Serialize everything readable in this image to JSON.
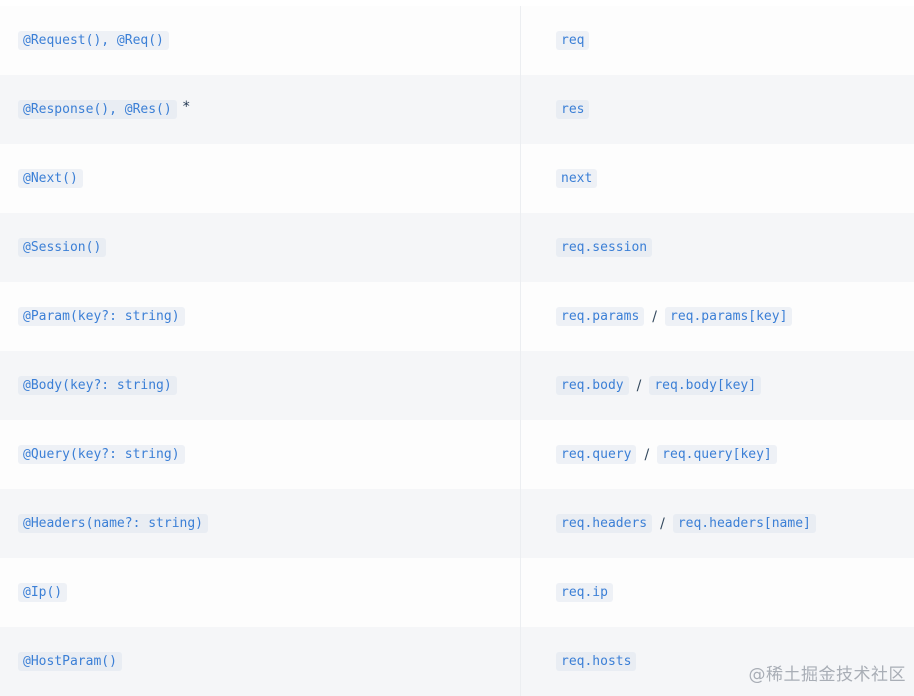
{
  "rows": [
    {
      "decorator": "@Request(), @Req()",
      "note": "",
      "express": [
        "req"
      ]
    },
    {
      "decorator": "@Response(), @Res()",
      "note": "*",
      "express": [
        "res"
      ]
    },
    {
      "decorator": "@Next()",
      "note": "",
      "express": [
        "next"
      ]
    },
    {
      "decorator": "@Session()",
      "note": "",
      "express": [
        "req.session"
      ]
    },
    {
      "decorator": "@Param(key?: string)",
      "note": "",
      "express": [
        "req.params",
        "req.params[key]"
      ]
    },
    {
      "decorator": "@Body(key?: string)",
      "note": "",
      "express": [
        "req.body",
        "req.body[key]"
      ]
    },
    {
      "decorator": "@Query(key?: string)",
      "note": "",
      "express": [
        "req.query",
        "req.query[key]"
      ]
    },
    {
      "decorator": "@Headers(name?: string)",
      "note": "",
      "express": [
        "req.headers",
        "req.headers[name]"
      ]
    },
    {
      "decorator": "@Ip()",
      "note": "",
      "express": [
        "req.ip"
      ]
    },
    {
      "decorator": "@HostParam()",
      "note": "",
      "express": [
        "req.hosts"
      ]
    }
  ],
  "separator": "/",
  "watermark": "@稀土掘金技术社区"
}
